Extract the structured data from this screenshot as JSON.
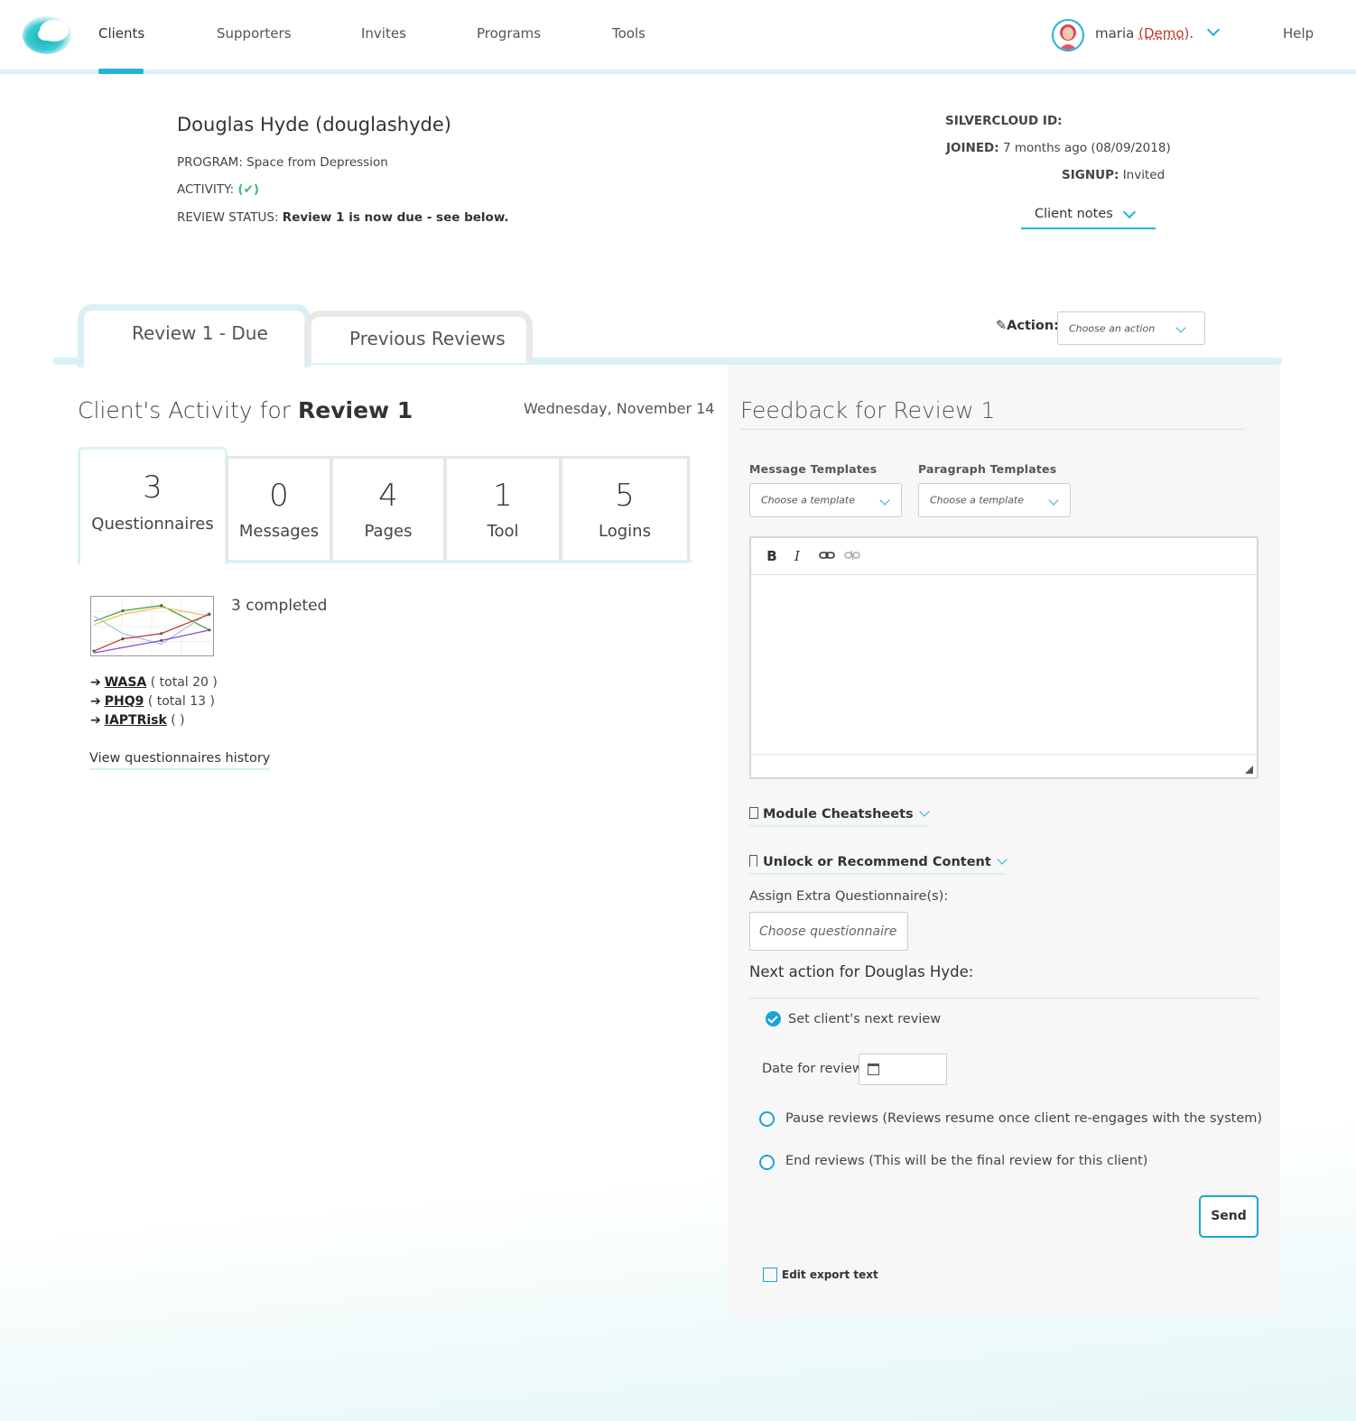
{
  "nav": {
    "items": [
      "Clients",
      "Supporters",
      "Invites",
      "Programs",
      "Tools"
    ],
    "active_index": 0,
    "user": {
      "name": "maria",
      "demo": "(Demo)",
      "suffix": "."
    },
    "help": "Help"
  },
  "client": {
    "name": "Douglas Hyde (douglashyde)",
    "program_label": "PROGRAM:",
    "program_value": "Space from Depression",
    "activity_label": "ACTIVITY:",
    "activity_value": "(✔)",
    "review_label": "REVIEW STATUS:",
    "review_value": "Review 1 is now due - see below.",
    "silvercloud_label": "SILVERCLOUD ID:",
    "joined_label": "JOINED:",
    "joined_value": "7 months ago (08/09/2018)",
    "signup_label": "SIGNUP:",
    "signup_value": "Invited",
    "notes_label": "Client notes"
  },
  "tabs": {
    "active": "Review 1 - Due",
    "inactive": "Previous Reviews",
    "action_label": "Action:",
    "action_placeholder": "Choose an action"
  },
  "activity": {
    "title_prefix": "Client's Activity for",
    "title_bold": "Review 1",
    "date": "Wednesday, November 14",
    "stats": [
      {
        "num": "3",
        "label": "Questionnaires"
      },
      {
        "num": "0",
        "label": "Messages"
      },
      {
        "num": "4",
        "label": "Pages"
      },
      {
        "num": "1",
        "label": "Tool"
      },
      {
        "num": "5",
        "label": "Logins"
      }
    ],
    "completed": "3 completed",
    "questionnaires": [
      {
        "name": "WASA",
        "detail": "( total 20 )"
      },
      {
        "name": "PHQ9",
        "detail": "( total 13 )"
      },
      {
        "name": "IAPTRisk",
        "detail": "( )"
      }
    ],
    "history_link": "View questionnaires history"
  },
  "feedback": {
    "title": "Feedback for Review 1",
    "message_templates_label": "Message Templates",
    "paragraph_templates_label": "Paragraph Templates",
    "template_placeholder": "Choose a template",
    "toolbar": {
      "bold": "B",
      "italic": "I"
    },
    "module_cheatsheets": "Module Cheatsheets",
    "unlock_content": "Unlock or Recommend Content",
    "assign_label": "Assign Extra Questionnaire(s):",
    "questionnaire_placeholder": "Choose questionnaire",
    "next_action_title": "Next action for Douglas Hyde:",
    "set_next_review": "Set client's next review",
    "date_label": "Date for review:",
    "pause_reviews": "Pause reviews (Reviews resume once client re-engages with the system)",
    "end_reviews": "End reviews (This will be the final review for this client)",
    "send": "Send",
    "edit_export": "Edit export text"
  },
  "colors": {
    "accent": "#20b3d6",
    "accent_light": "#d9f1f5",
    "check": "#3cb878",
    "demo": "#c0392b"
  }
}
